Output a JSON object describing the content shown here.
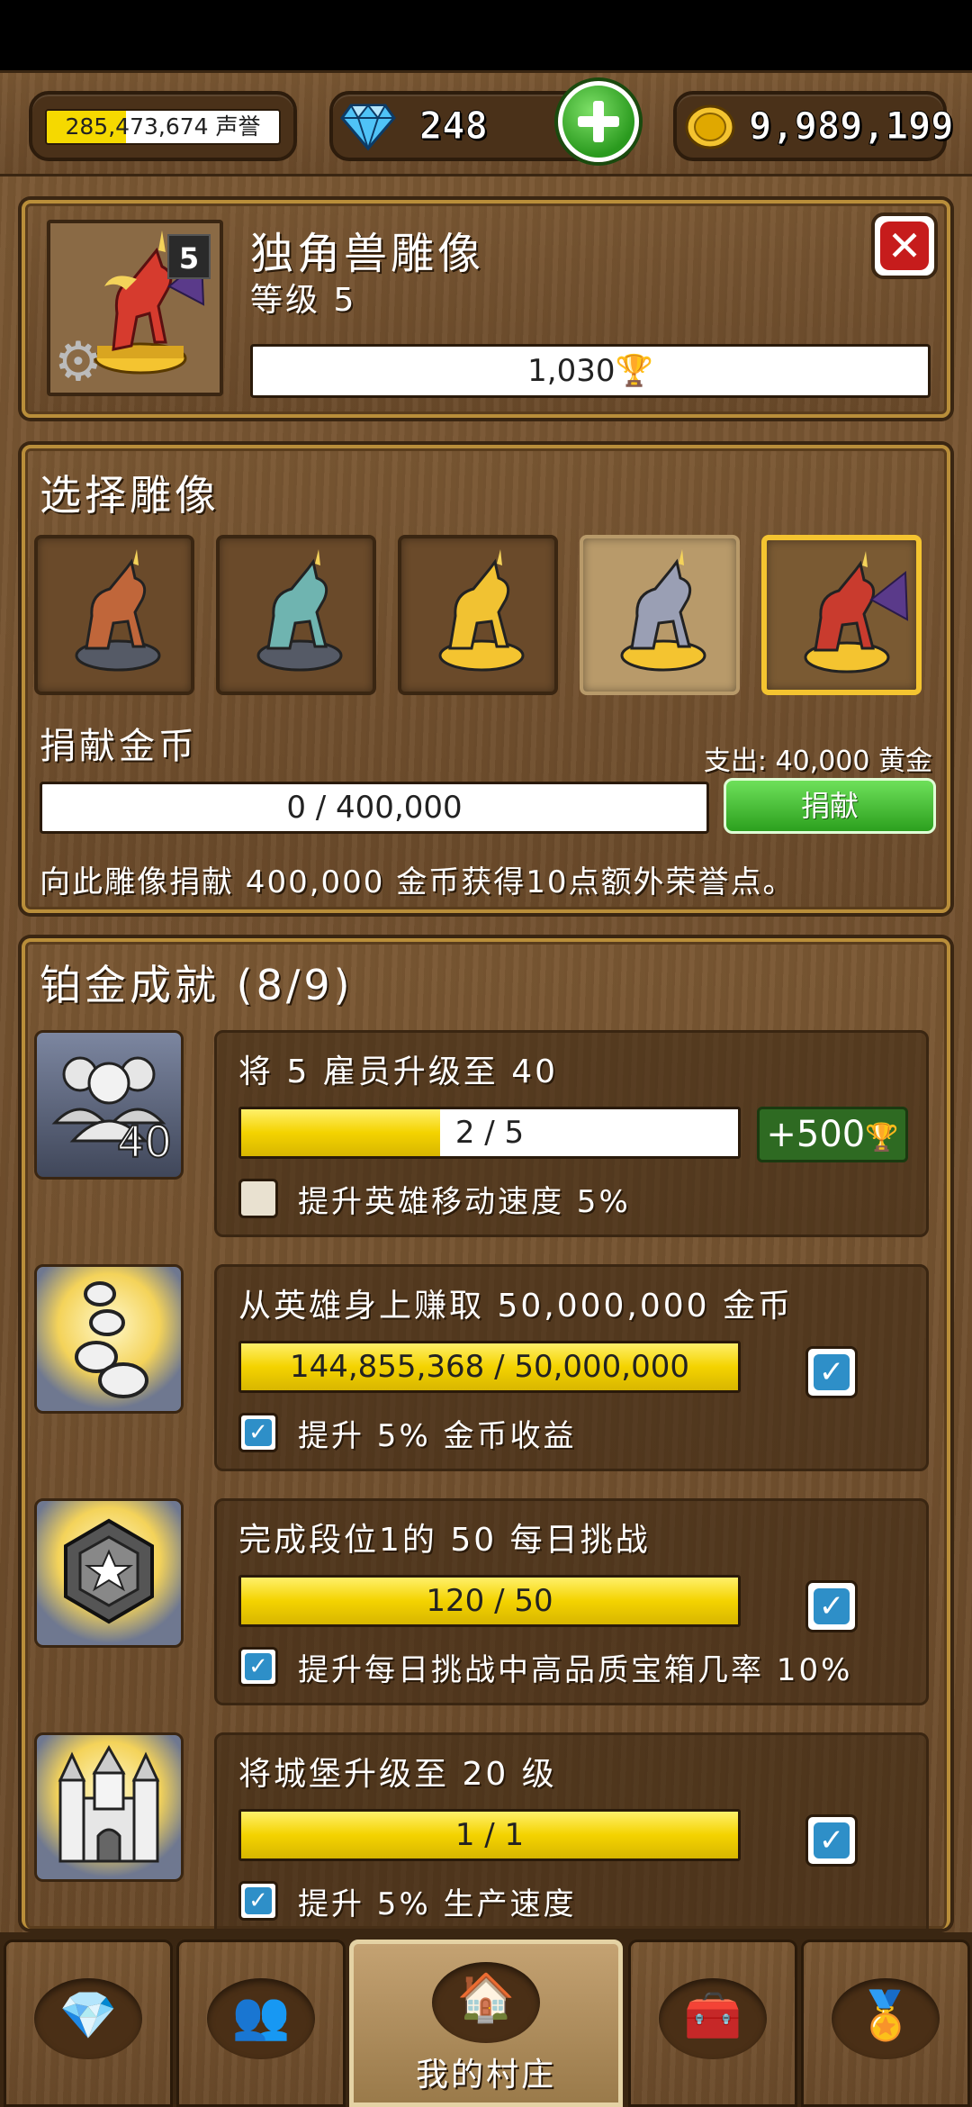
{
  "topbar": {
    "reputation_text": "285,473,674 声誉",
    "reputation_progress": 0.34,
    "gems": "248",
    "gold": "9,989,199",
    "icons": [
      "diamond-icon",
      "plus-icon",
      "gold-coin-icon"
    ]
  },
  "statue_panel": {
    "level_badge": "5",
    "title": "独角兽雕像",
    "level_text": "等级 5",
    "trophy_value": "1,030",
    "icons": [
      "unicorn-statue-icon",
      "gear-icon",
      "trophy-icon",
      "close-icon"
    ]
  },
  "select_panel": {
    "title": "选择雕像",
    "statues": [
      {
        "name": "bronze-unicorn",
        "color": "#c0663a",
        "state": "normal"
      },
      {
        "name": "teal-unicorn",
        "color": "#6fb4b0",
        "state": "normal"
      },
      {
        "name": "golden-unicorn",
        "color": "#f1c232",
        "state": "normal"
      },
      {
        "name": "silver-unicorn",
        "color": "#9a9fb4",
        "state": "faded"
      },
      {
        "name": "red-winged-unicorn",
        "color": "#c93b2e",
        "state": "selected"
      }
    ],
    "donate_label": "捐献金币",
    "spend_label": "支出: 40,000 黄金",
    "donate_progress": "0 / 400,000",
    "donate_button": "捐献",
    "note": "向此雕像捐献 400,000 金币获得10点额外荣誉点。"
  },
  "achievements": {
    "title": "铂金成就 (8/9)",
    "items": [
      {
        "title": "将 5 雇员升级至 40",
        "progress_text": "2 / 5",
        "progress": 0.4,
        "reward": "+500",
        "completed": false,
        "bonus": "提升英雄移动速度 5%",
        "icon_badge": "40",
        "icon": "employees-icon"
      },
      {
        "title": "从英雄身上赚取 50,000,000 金币",
        "progress_text": "144,855,368 / 50,000,000",
        "progress": 1.0,
        "completed": true,
        "bonus": "提升 5% 金币收益",
        "icon": "coins-icon"
      },
      {
        "title": "完成段位1的 50 每日挑战",
        "progress_text": "120 / 50",
        "progress": 1.0,
        "completed": true,
        "bonus": "提升每日挑战中高品质宝箱几率 10%",
        "icon": "star-medal-icon"
      },
      {
        "title": "将城堡升级至 20 级",
        "progress_text": "1 / 1",
        "progress": 1.0,
        "completed": true,
        "bonus": "提升 5% 生产速度",
        "icon": "castle-icon"
      }
    ]
  },
  "bottom_nav": {
    "tabs": [
      {
        "name": "tab-gems",
        "icon": "diamond-icon",
        "glyph": "💎"
      },
      {
        "name": "tab-heroes",
        "icon": "people-icon",
        "glyph": "👥"
      },
      {
        "name": "tab-village",
        "icon": "house-icon",
        "glyph": "🏠",
        "label": "我的村庄",
        "active": true
      },
      {
        "name": "tab-chest",
        "icon": "chest-icon",
        "glyph": "🧰"
      },
      {
        "name": "tab-achievements",
        "icon": "medal-icon",
        "glyph": "🏅"
      }
    ]
  },
  "colors": {
    "wood": "#6f4e2c",
    "frame_gold": "#b98e3a",
    "progress_yellow": "#f4d300",
    "reward_green": "#2e6a22",
    "check_blue": "#2e8fc8",
    "close_red": "#c61c1c"
  }
}
